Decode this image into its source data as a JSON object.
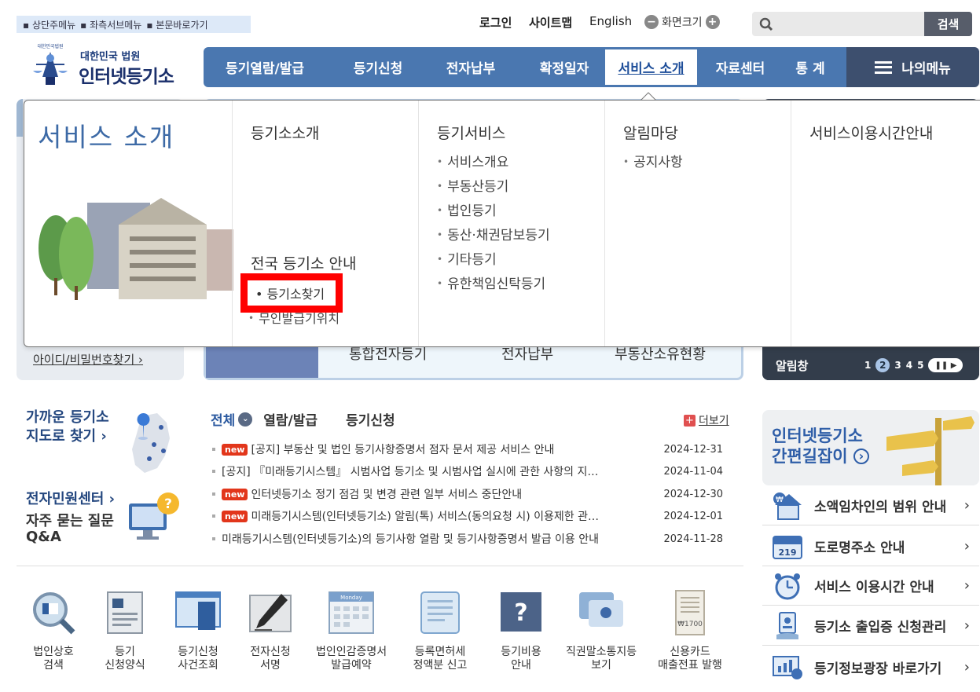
{
  "skip_links": [
    "상단주메뉴",
    "좌측서브메뉴",
    "본문바로가기"
  ],
  "util": {
    "login": "로그인",
    "sitemap": "사이트맵",
    "english": "English",
    "zoom": "화면크기",
    "zoom_minus": "−",
    "zoom_plus": "+"
  },
  "search": {
    "placeholder": "",
    "button": "검색"
  },
  "logo": {
    "small": "대한민국 법원",
    "big": "인터넷등기소",
    "seal_text": "대한민국법원"
  },
  "gnb": [
    "등기열람/발급",
    "등기신청",
    "전자납부",
    "확정일자",
    "서비스 소개",
    "자료센터",
    "통 계"
  ],
  "mymenu": "나의메뉴",
  "login_box": {
    "find": "아이디/비밀번호찾기 ›"
  },
  "quick_peek": [
    "통합전자등기",
    "전자납부",
    "부동산소유현황"
  ],
  "notice_peek": {
    "label": "알림창",
    "pages": [
      "1",
      "2",
      "3",
      "4",
      "5"
    ],
    "current": "2",
    "controls": "❚❚ ▶"
  },
  "mega": {
    "title": "서비스 소개",
    "col1": {
      "heading": "등기소소개",
      "sub_heading": "전국 등기소 안내",
      "find": "• 등기소찾기",
      "hidden_item": "무인발급기위치"
    },
    "col2": {
      "heading": "등기서비스",
      "items": [
        "서비스개요",
        "부동산등기",
        "법인등기",
        "동산·채권담보등기",
        "기타등기",
        "유한책임신탁등기"
      ]
    },
    "col3": {
      "heading": "알림마당",
      "items": [
        "공지사항"
      ]
    },
    "col4": {
      "heading": "서비스이용시간안내"
    }
  },
  "map_box": {
    "title_l1": "가까운 등기소",
    "title_l2": "지도로 찾기 ›"
  },
  "center": {
    "title": "전자민원센터 ›",
    "faq_l1": "자주 묻는 질문",
    "faq_l2": "Q&A"
  },
  "notice_tabs": {
    "all": "전체",
    "all_icon": "⌄",
    "view": "열람/발급",
    "apply": "등기신청",
    "more_icon": "+",
    "more": "더보기"
  },
  "notices": [
    {
      "new": "new",
      "text": "[공지] 부동산 및 법인 등기사항증명서 점자 문서 제공 서비스 안내",
      "date": "2024-12-31"
    },
    {
      "new": "",
      "text": "[공지] 『미래등기시스템』 시범사업 등기소 및 시범사업 실시에 관한 사항의 지…",
      "date": "2024-11-04"
    },
    {
      "new": "new",
      "text": "인터넷등기소 정기 점검 및 변경 관련 일부 서비스 중단안내",
      "date": "2024-12-30"
    },
    {
      "new": "new",
      "text": "미래등기시스템(인터넷등기소) 알림(톡) 서비스(동의요청 시) 이용제한 관…",
      "date": "2024-12-01"
    },
    {
      "new": "",
      "text": "미래등기시스템(인터넷등기소)의 등기사항 열람 및 등기사항증명서 발급 이용 안내",
      "date": "2024-11-28"
    }
  ],
  "icons": [
    {
      "l1": "법인상호",
      "l2": "검색"
    },
    {
      "l1": "등기",
      "l2": "신청양식"
    },
    {
      "l1": "등기신청",
      "l2": "사건조회"
    },
    {
      "l1": "전자신청",
      "l2": "서명"
    },
    {
      "l1": "법인인감증명서",
      "l2": "발급예약",
      "pic_text": "Monday"
    },
    {
      "l1": "등록면허세",
      "l2": "정액분 신고"
    },
    {
      "l1": "등기비용",
      "l2": "안내"
    },
    {
      "l1": "직권말소통지등",
      "l2": "보기"
    },
    {
      "l1": "신용카드",
      "l2": "매출전표 발행",
      "pic_text": "₩1700"
    }
  ],
  "guide": {
    "l1": "인터넷등기소",
    "l2": "간편길잡이",
    "l2_icon": "›"
  },
  "right_links": [
    {
      "text": "소액임차인의 범위 안내",
      "icon_text": "₩"
    },
    {
      "text": "도로명주소 안내",
      "icon_text": "219"
    },
    {
      "text": "서비스 이용시간 안내"
    },
    {
      "text": "등기소 출입증 신청관리"
    },
    {
      "text": "등기정보광장 바로가기"
    }
  ],
  "right_link_chevron": "›",
  "colors": {
    "gnb": "#4a77b0",
    "mymenu": "#3d4f6e",
    "highlight": "#ff0000",
    "new_badge": "#e2361b",
    "title_blue": "#3d6aa6"
  }
}
